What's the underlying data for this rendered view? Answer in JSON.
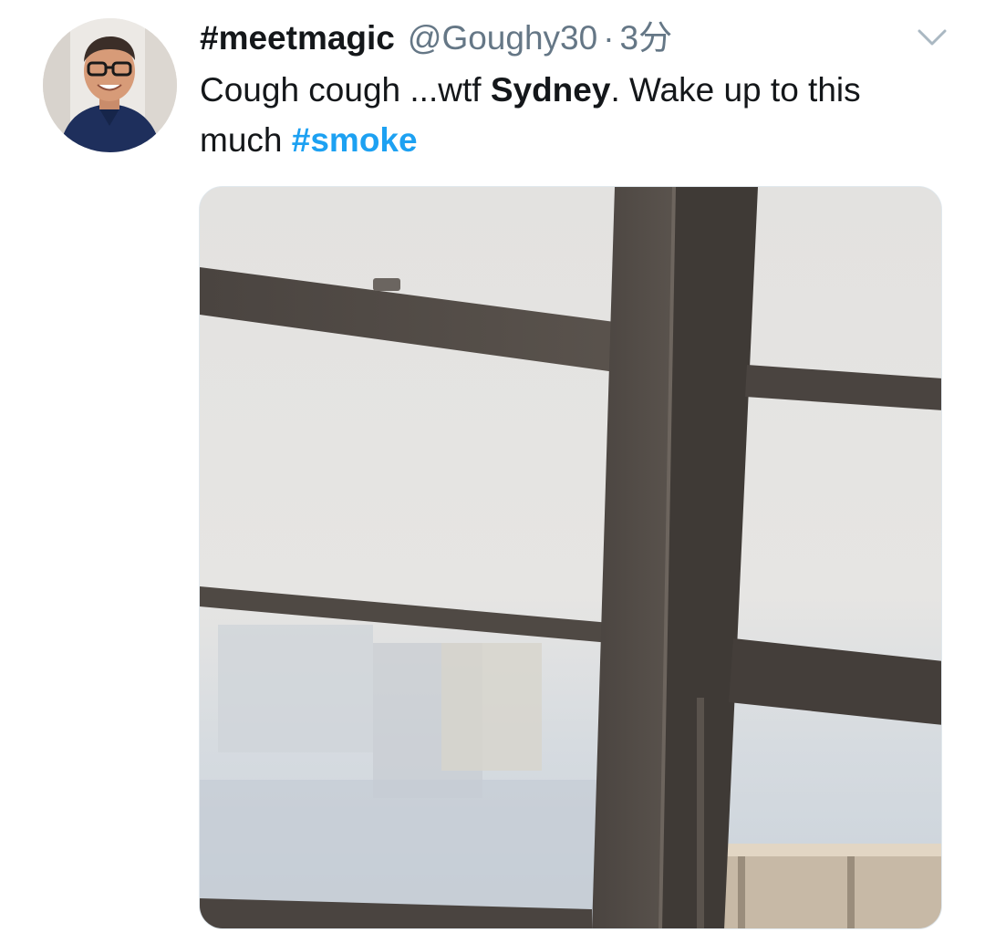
{
  "tweet": {
    "display_name": "#meetmagic",
    "handle": "@Goughy30",
    "separator": "·",
    "time": "3分",
    "text_part1": "Cough cough ...wtf ",
    "text_bold": "Sydney",
    "text_part2": ".  Wake up to this much ",
    "hashtag": "#smoke",
    "hashtag_color": "#1da1f2",
    "name_color": "#14171a",
    "meta_color": "#657786"
  },
  "icons": {
    "caret": "chevron-down-icon"
  },
  "media": {
    "description_icon": "photo"
  }
}
